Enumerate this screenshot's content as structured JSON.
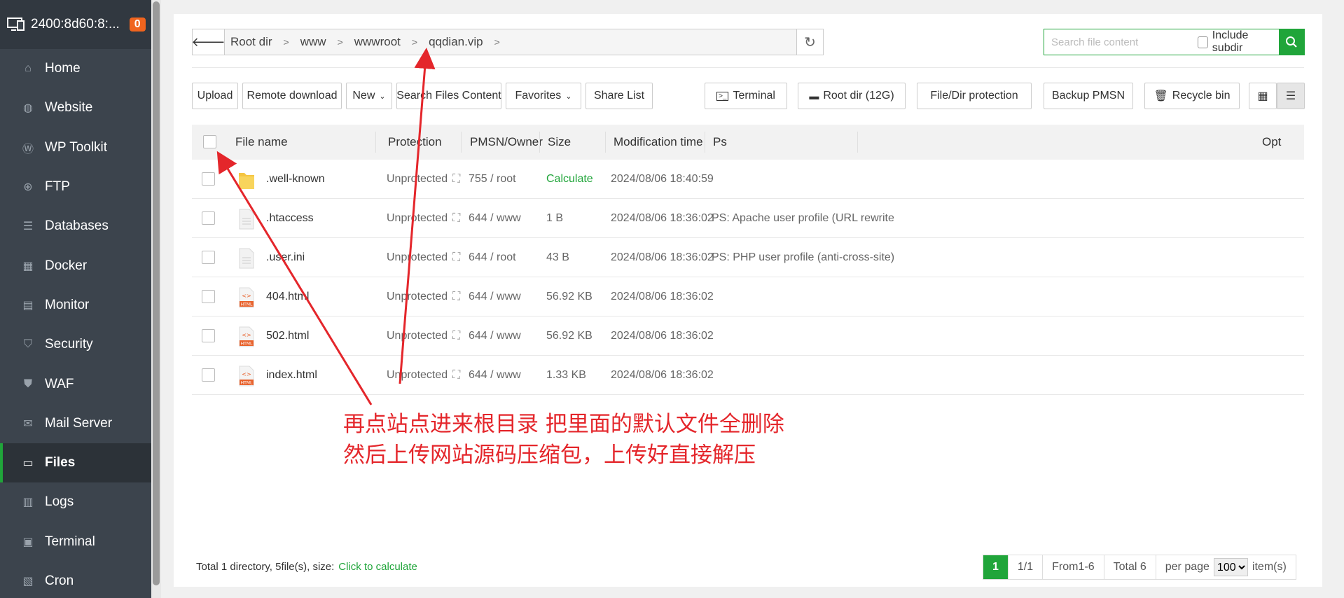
{
  "sidebar": {
    "host": "2400:8d60:8:...",
    "badge": "0",
    "items": [
      {
        "label": "Home"
      },
      {
        "label": "Website"
      },
      {
        "label": "WP Toolkit"
      },
      {
        "label": "FTP"
      },
      {
        "label": "Databases"
      },
      {
        "label": "Docker"
      },
      {
        "label": "Monitor"
      },
      {
        "label": "Security"
      },
      {
        "label": "WAF"
      },
      {
        "label": "Mail Server"
      },
      {
        "label": "Files"
      },
      {
        "label": "Logs"
      },
      {
        "label": "Terminal"
      },
      {
        "label": "Cron"
      }
    ]
  },
  "path": {
    "crumbs": [
      "Root dir",
      "www",
      "wwwroot",
      "qqdian.vip"
    ]
  },
  "search": {
    "placeholder": "Search file content",
    "include_subdir": "Include subdir"
  },
  "toolbar": {
    "upload": "Upload",
    "remote_download": "Remote download",
    "new": "New",
    "search_files": "Search Files Content",
    "favorites": "Favorites",
    "share_list": "Share List",
    "terminal": "Terminal",
    "root_dir": "Root dir (12G)",
    "protection": "File/Dir protection",
    "backup": "Backup PMSN",
    "recycle": "Recycle bin"
  },
  "table": {
    "headers": {
      "name": "File name",
      "protection": "Protection",
      "owner": "PMSN/Owner",
      "size": "Size",
      "mtime": "Modification time",
      "ps": "Ps",
      "opt": "Opt"
    },
    "rows": [
      {
        "name": ".well-known",
        "type": "folder",
        "protection": "Unprotected",
        "owner": "755 / root",
        "size": "Calculate",
        "mtime": "2024/08/06 18:40:59",
        "ps": ""
      },
      {
        "name": ".htaccess",
        "type": "file",
        "protection": "Unprotected",
        "owner": "644 / www",
        "size": "1 B",
        "mtime": "2024/08/06 18:36:02",
        "ps": "PS: Apache user profile (URL rewrite"
      },
      {
        "name": ".user.ini",
        "type": "file",
        "protection": "Unprotected",
        "owner": "644 / root",
        "size": "43 B",
        "mtime": "2024/08/06 18:36:02",
        "ps": "PS: PHP user profile (anti-cross-site)"
      },
      {
        "name": "404.html",
        "type": "html",
        "protection": "Unprotected",
        "owner": "644 / www",
        "size": "56.92 KB",
        "mtime": "2024/08/06 18:36:02",
        "ps": ""
      },
      {
        "name": "502.html",
        "type": "html",
        "protection": "Unprotected",
        "owner": "644 / www",
        "size": "56.92 KB",
        "mtime": "2024/08/06 18:36:02",
        "ps": ""
      },
      {
        "name": "index.html",
        "type": "html",
        "protection": "Unprotected",
        "owner": "644 / www",
        "size": "1.33 KB",
        "mtime": "2024/08/06 18:36:02",
        "ps": ""
      }
    ]
  },
  "annotation": {
    "line1": "再点站点进来根目录  把里面的默认文件全删除",
    "line2": "然后上传网站源码压缩包，上传好直接解压"
  },
  "footer": {
    "summary": "Total 1 directory, 5file(s), size:",
    "calc_link": "Click to calculate",
    "page": "1",
    "pages": "1/1",
    "range": "From1-6",
    "total": "Total 6",
    "per_page": "per page",
    "per_page_value": "100",
    "items": "item(s)"
  },
  "colors": {
    "accent": "#20a53a",
    "sidebar": "#3c444d",
    "annotation": "#e4262b"
  }
}
